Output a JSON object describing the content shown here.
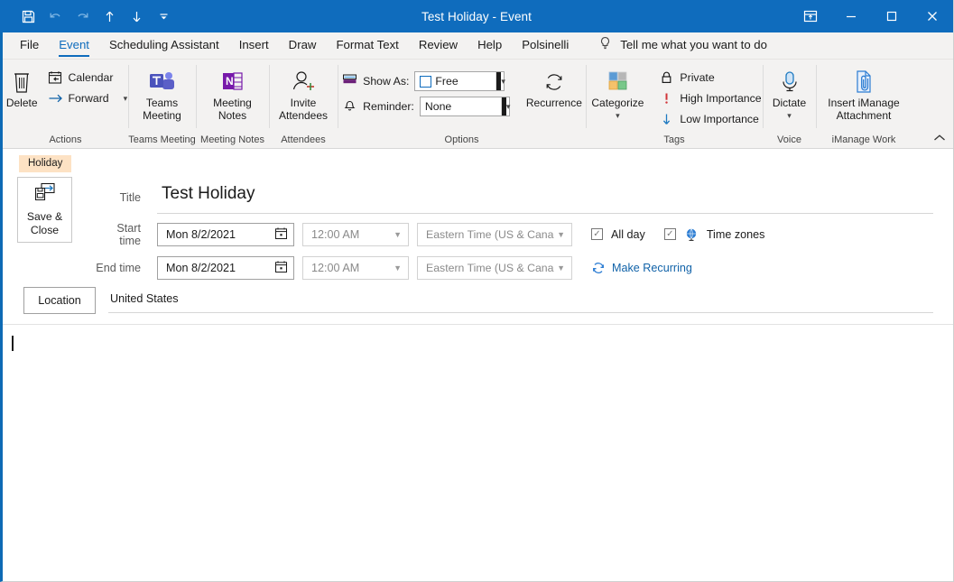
{
  "window": {
    "title": "Test Holiday  -  Event",
    "quick_access": [
      {
        "name": "save-icon",
        "label": "Save"
      },
      {
        "name": "undo-icon",
        "label": "Undo"
      },
      {
        "name": "redo-icon",
        "label": "Redo"
      },
      {
        "name": "up-arrow-icon",
        "label": "Previous Item"
      },
      {
        "name": "down-arrow-icon",
        "label": "Next Item"
      },
      {
        "name": "customize-quick-access-icon",
        "label": "Customize Quick Access Toolbar"
      }
    ],
    "controls": [
      {
        "name": "ribbon-display-options",
        "label": "Ribbon Display Options"
      },
      {
        "name": "minimize-button",
        "label": "Minimize"
      },
      {
        "name": "maximize-button",
        "label": "Maximize"
      },
      {
        "name": "close-button",
        "label": "Close"
      }
    ],
    "accent_color": "#0f6cbd"
  },
  "tabs": [
    {
      "label": "File",
      "active": false
    },
    {
      "label": "Event",
      "active": true
    },
    {
      "label": "Scheduling Assistant",
      "active": false
    },
    {
      "label": "Insert",
      "active": false
    },
    {
      "label": "Draw",
      "active": false
    },
    {
      "label": "Format Text",
      "active": false
    },
    {
      "label": "Review",
      "active": false
    },
    {
      "label": "Help",
      "active": false
    },
    {
      "label": "Polsinelli",
      "active": false
    }
  ],
  "tell_me": "Tell me what you want to do",
  "ribbon": {
    "groups": {
      "actions": {
        "label": "Actions",
        "delete": "Delete",
        "calendar": "Calendar",
        "forward": "Forward"
      },
      "teams_meeting": {
        "label": "Teams Meeting",
        "button_line1": "Teams",
        "button_line2": "Meeting"
      },
      "meeting_notes": {
        "label": "Meeting Notes",
        "button_line1": "Meeting",
        "button_line2": "Notes"
      },
      "attendees": {
        "label": "Attendees",
        "button_line1": "Invite",
        "button_line2": "Attendees"
      },
      "options": {
        "label": "Options",
        "show_as_label": "Show As:",
        "show_as_value": "Free",
        "reminder_label": "Reminder:",
        "reminder_value": "None",
        "recurrence": "Recurrence"
      },
      "tags": {
        "label": "Tags",
        "categorize": "Categorize",
        "private": "Private",
        "high_importance": "High Importance",
        "low_importance": "Low Importance"
      },
      "voice": {
        "label": "Voice",
        "dictate": "Dictate"
      },
      "imanage": {
        "label": "iManage Work",
        "button_line1": "Insert iManage",
        "button_line2": "Attachment"
      }
    },
    "collapse_label": "Collapse the Ribbon"
  },
  "form": {
    "category_badge": "Holiday",
    "save_close_line1": "Save &",
    "save_close_line2": "Close",
    "title_label": "Title",
    "title_value": "Test Holiday",
    "start_label": "Start time",
    "end_label": "End time",
    "start_date": "Mon 8/2/2021",
    "start_time": "12:00 AM",
    "start_timezone": "Eastern Time (US & Cana",
    "end_date": "Mon 8/2/2021",
    "end_time": "12:00 AM",
    "end_timezone": "Eastern Time (US & Cana",
    "all_day_label": "All day",
    "all_day_checked": true,
    "time_zones_label": "Time zones",
    "time_zones_checked": true,
    "make_recurring": "Make Recurring",
    "location_label": "Location",
    "location_value": "United States",
    "body_value": ""
  }
}
